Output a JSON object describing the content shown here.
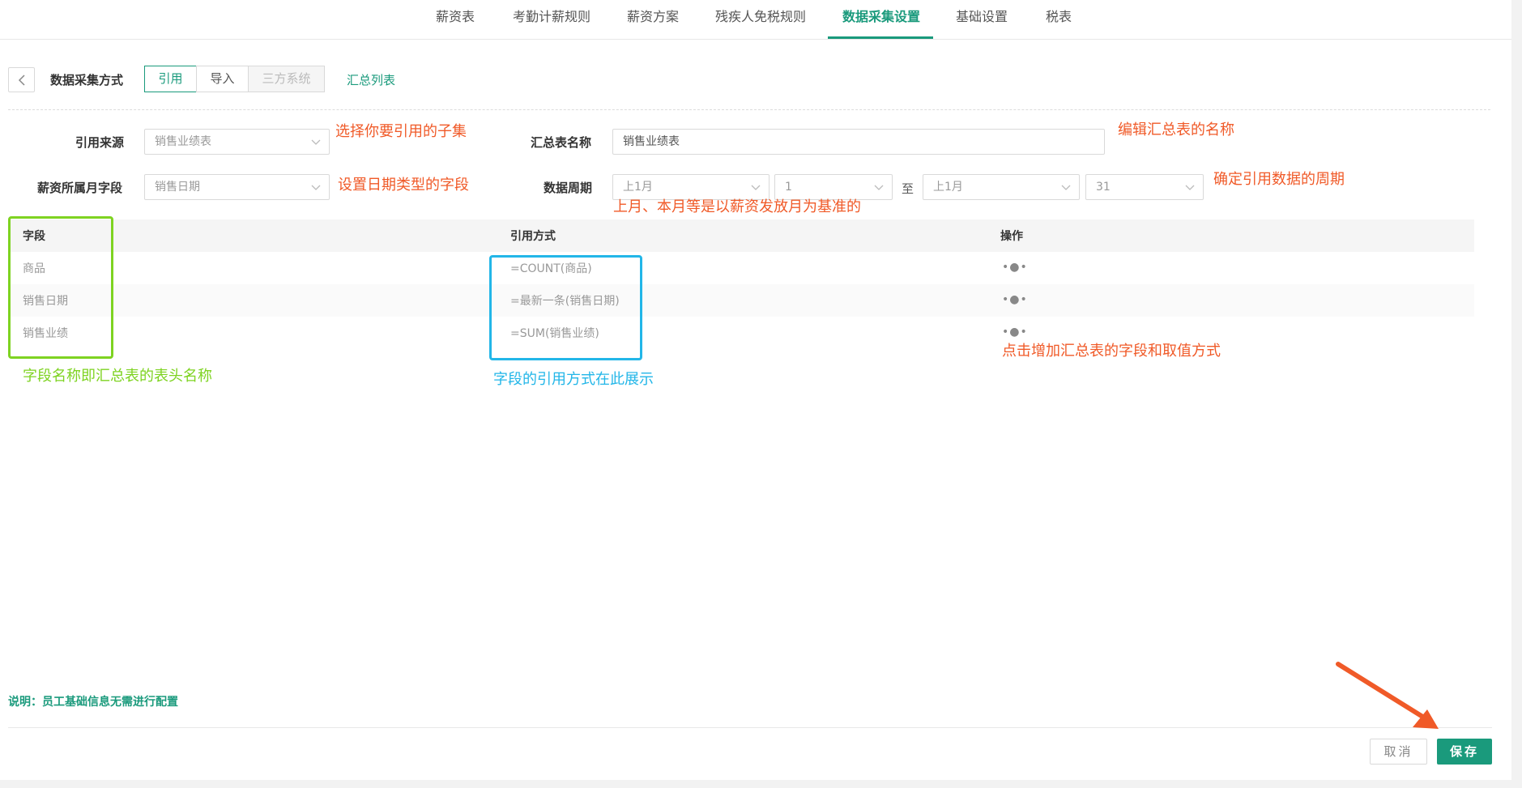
{
  "tabs": [
    {
      "label": "薪资表",
      "active": false
    },
    {
      "label": "考勤计薪规则",
      "active": false
    },
    {
      "label": "薪资方案",
      "active": false
    },
    {
      "label": "残疾人免税规则",
      "active": false
    },
    {
      "label": "数据采集设置",
      "active": true
    },
    {
      "label": "基础设置",
      "active": false
    },
    {
      "label": "税表",
      "active": false
    }
  ],
  "method": {
    "label": "数据采集方式",
    "options": [
      {
        "label": "引用",
        "state": "active"
      },
      {
        "label": "导入",
        "state": "normal"
      },
      {
        "label": "三方系统",
        "state": "disabled"
      }
    ],
    "summary_link": "汇总列表"
  },
  "form": {
    "source_label": "引用来源",
    "source_value": "销售业绩表",
    "month_field_label": "薪资所属月字段",
    "month_field_value": "销售日期",
    "summary_name_label": "汇总表名称",
    "summary_name_value": "销售业绩表",
    "period_label": "数据周期",
    "period_start_month": "上1月",
    "period_start_day": "1",
    "period_sep": "至",
    "period_end_month": "上1月",
    "period_end_day": "31"
  },
  "annotations": {
    "source_hint": "选择你要引用的子集",
    "month_field_hint": "设置日期类型的字段",
    "summary_name_hint": "编辑汇总表的名称",
    "period_hint": "确定引用数据的周期",
    "period_basis_hint": "上月、本月等是以薪资发放月为基准的",
    "field_hint": "字段名称即汇总表的表头名称",
    "method_hint": "字段的引用方式在此展示",
    "add_hint": "点击增加汇总表的字段和取值方式"
  },
  "table": {
    "headers": {
      "field": "字段",
      "method": "引用方式",
      "action": "操作"
    },
    "rows": [
      {
        "field": "商品",
        "method": "=COUNT(商品)",
        "action": "•●•"
      },
      {
        "field": "销售日期",
        "method": "=最新一条(销售日期)",
        "action": "•●•"
      },
      {
        "field": "销售业绩",
        "method": "=SUM(销售业绩)",
        "action": "•●•"
      }
    ]
  },
  "footer": {
    "note": "说明：员工基础信息无需进行配置",
    "cancel_label": "取消",
    "save_label": "保存"
  },
  "colors": {
    "accent": "#1a9a7c",
    "annotation_orange": "#f05a28",
    "annotation_green": "#7ed321",
    "annotation_blue": "#22b6e8"
  }
}
